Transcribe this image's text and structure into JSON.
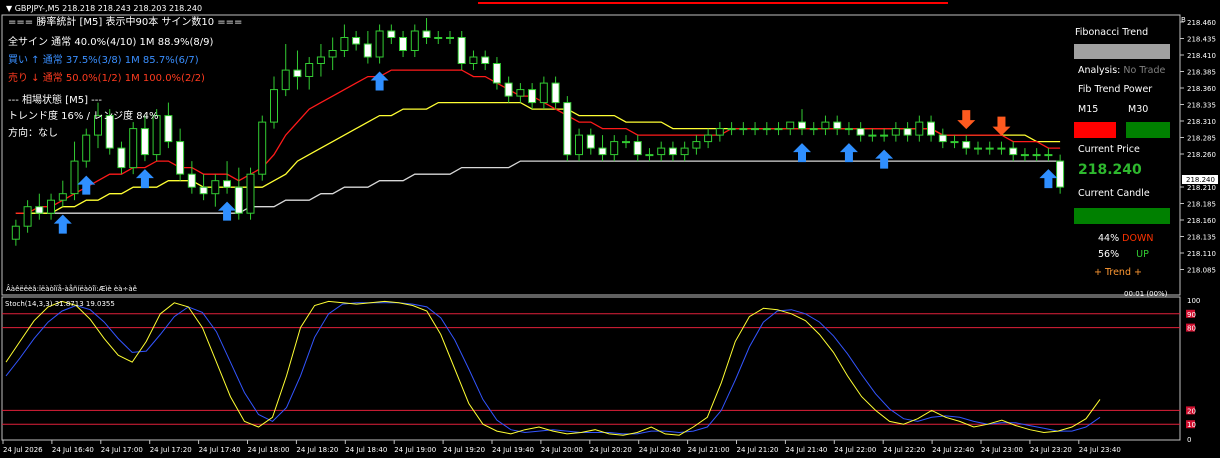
{
  "header": {
    "symbol_line": "▼ GBPJPY-,M5  218.218 218.243 218.203 218.240"
  },
  "stats": {
    "title": "=== 勝率統計 [M5] 表示中90本 サイン数10 ===",
    "all_label": "全サイン  通常 40.0%(4/10)    1M 88.9%(8/9)",
    "buy_label": "買い ↑    通常 37.5%(3/8)    1M 85.7%(6/7)",
    "sell_label": "売り ↓    通常 50.0%(1/2)    1M 100.0%(2/2)",
    "state_title": "--- 相場状態 [M5] ---",
    "trend_label": "トレンド度 16% / レンジ度 84%",
    "direction_label": "方向：なし",
    "garbled_label": "Âàêëëèâ:ïëàòîïå-àåñíëàòîï:Æìè èà÷àê"
  },
  "panel": {
    "title": "Fibonacci Trend",
    "analysis_label": "Analysis:",
    "analysis_value": "No Trade",
    "power_label": "Fib Trend Power",
    "m15_label": "M15",
    "m30_label": "M30",
    "current_price_label": "Current Price",
    "current_price_value": "218.240",
    "current_candle_label": "Current Candle",
    "down_pct": "44%",
    "down_label": "DOWN",
    "up_pct": "56%",
    "up_label": "UP",
    "trend_label": "+  Trend  +",
    "timer_label": "00:01 (00%)",
    "colors": {
      "title_bar": "#a0a0a0",
      "m15": "#ff0000",
      "m30": "#008000",
      "price": "#2eb82e",
      "candle": "#008000",
      "down": "#ff3300",
      "up": "#33cc33",
      "trend": "#ff9933",
      "analysis_value": "#808080"
    }
  },
  "stochastic": {
    "label": "Stoch(14,3,3) 31.8713 19.0355",
    "axis_top": "100",
    "axis_bottom": "0",
    "levels": [
      "90",
      "80",
      "20",
      "10"
    ]
  },
  "price_axis": {
    "ticks": [
      "218.460",
      "218.435",
      "218.410",
      "218.385",
      "218.360",
      "218.335",
      "218.310",
      "218.285",
      "218.260",
      "218.240",
      "218.210",
      "218.185",
      "218.160",
      "218.135",
      "218.110",
      "218.085"
    ],
    "current_tag": "218.240",
    "corner_letter": "B"
  },
  "time_axis": {
    "ticks": [
      "24 Jul 2026",
      "24 Jul 16:40",
      "24 Jul 17:00",
      "24 Jul 17:20",
      "24 Jul 17:40",
      "24 Jul 18:00",
      "24 Jul 18:20",
      "24 Jul 18:40",
      "24 Jul 19:00",
      "24 Jul 19:20",
      "24 Jul 19:40",
      "24 Jul 20:00",
      "24 Jul 20:20",
      "24 Jul 20:40",
      "24 Jul 21:00",
      "24 Jul 21:20",
      "24 Jul 21:40",
      "24 Jul 22:00",
      "24 Jul 22:20",
      "24 Jul 22:40",
      "24 Jul 23:00",
      "24 Jul 23:20",
      "24 Jul 23:40"
    ]
  },
  "chart_data": {
    "type": "candlestick",
    "symbol": "GBPJPY-",
    "timeframe": "M5",
    "ylim": [
      218.075,
      218.47
    ],
    "candles": [
      [
        218.13,
        218.16,
        218.12,
        218.15
      ],
      [
        218.15,
        218.19,
        218.14,
        218.18
      ],
      [
        218.18,
        218.2,
        218.16,
        218.17
      ],
      [
        218.17,
        218.2,
        218.16,
        218.19
      ],
      [
        218.19,
        218.22,
        218.18,
        218.2
      ],
      [
        218.2,
        218.28,
        218.19,
        218.25
      ],
      [
        218.25,
        218.3,
        218.24,
        218.29
      ],
      [
        218.29,
        218.34,
        218.27,
        218.32
      ],
      [
        218.32,
        218.33,
        218.26,
        218.27
      ],
      [
        218.27,
        218.28,
        218.23,
        218.24
      ],
      [
        218.24,
        218.31,
        218.23,
        218.3
      ],
      [
        218.3,
        218.32,
        218.25,
        218.26
      ],
      [
        218.26,
        218.33,
        218.25,
        218.32
      ],
      [
        218.32,
        218.34,
        218.27,
        218.28
      ],
      [
        218.28,
        218.3,
        218.22,
        218.23
      ],
      [
        218.23,
        218.25,
        218.2,
        218.21
      ],
      [
        218.21,
        218.23,
        218.19,
        218.2
      ],
      [
        218.2,
        218.23,
        218.18,
        218.22
      ],
      [
        218.22,
        218.25,
        218.2,
        218.21
      ],
      [
        218.21,
        218.24,
        218.16,
        218.17
      ],
      [
        218.17,
        218.24,
        218.16,
        218.23
      ],
      [
        218.23,
        218.32,
        218.22,
        218.31
      ],
      [
        218.31,
        218.38,
        218.3,
        218.36
      ],
      [
        218.36,
        218.43,
        218.35,
        218.39
      ],
      [
        218.39,
        218.42,
        218.36,
        218.38
      ],
      [
        218.38,
        218.41,
        218.36,
        218.4
      ],
      [
        218.4,
        218.43,
        218.38,
        218.41
      ],
      [
        218.41,
        218.44,
        218.39,
        218.42
      ],
      [
        218.42,
        218.46,
        218.41,
        218.44
      ],
      [
        218.44,
        218.45,
        218.42,
        218.43
      ],
      [
        218.43,
        218.45,
        218.4,
        218.41
      ],
      [
        218.41,
        218.46,
        218.4,
        218.45
      ],
      [
        218.45,
        218.46,
        218.43,
        218.44
      ],
      [
        218.44,
        218.45,
        218.41,
        218.42
      ],
      [
        218.42,
        218.46,
        218.41,
        218.45
      ],
      [
        218.45,
        218.47,
        218.43,
        218.44
      ],
      [
        218.44,
        218.45,
        218.43,
        218.44
      ],
      [
        218.44,
        218.45,
        218.43,
        218.44
      ],
      [
        218.44,
        218.45,
        218.39,
        218.4
      ],
      [
        218.4,
        218.42,
        218.39,
        218.41
      ],
      [
        218.41,
        218.42,
        218.39,
        218.4
      ],
      [
        218.4,
        218.41,
        218.36,
        218.37
      ],
      [
        218.37,
        218.38,
        218.34,
        218.35
      ],
      [
        218.35,
        218.37,
        218.34,
        218.36
      ],
      [
        218.36,
        218.37,
        218.33,
        218.34
      ],
      [
        218.34,
        218.38,
        218.33,
        218.37
      ],
      [
        218.37,
        218.38,
        218.33,
        218.34
      ],
      [
        218.34,
        218.35,
        218.25,
        218.26
      ],
      [
        218.26,
        218.3,
        218.25,
        218.29
      ],
      [
        218.29,
        218.3,
        218.26,
        218.27
      ],
      [
        218.27,
        218.29,
        218.25,
        218.26
      ],
      [
        218.26,
        218.29,
        218.25,
        218.28
      ],
      [
        218.28,
        218.29,
        218.27,
        218.28
      ],
      [
        218.28,
        218.29,
        218.25,
        218.26
      ],
      [
        218.26,
        218.27,
        218.25,
        218.26
      ],
      [
        218.26,
        218.28,
        218.25,
        218.27
      ],
      [
        218.27,
        218.28,
        218.25,
        218.26
      ],
      [
        218.26,
        218.28,
        218.25,
        218.27
      ],
      [
        218.27,
        218.29,
        218.26,
        218.28
      ],
      [
        218.28,
        218.3,
        218.27,
        218.29
      ],
      [
        218.29,
        218.31,
        218.28,
        218.3
      ],
      [
        218.3,
        218.31,
        218.29,
        218.3
      ],
      [
        218.3,
        218.31,
        218.29,
        218.3
      ],
      [
        218.3,
        218.31,
        218.29,
        218.3
      ],
      [
        218.3,
        218.31,
        218.29,
        218.3
      ],
      [
        218.3,
        218.31,
        218.29,
        218.3
      ],
      [
        218.3,
        218.31,
        218.29,
        218.31
      ],
      [
        218.31,
        218.33,
        218.29,
        218.3
      ],
      [
        218.3,
        218.31,
        218.29,
        218.3
      ],
      [
        218.3,
        218.32,
        218.29,
        218.31
      ],
      [
        218.31,
        218.32,
        218.29,
        218.3
      ],
      [
        218.3,
        218.31,
        218.29,
        218.3
      ],
      [
        218.3,
        218.31,
        218.28,
        218.29
      ],
      [
        218.29,
        218.3,
        218.28,
        218.29
      ],
      [
        218.29,
        218.3,
        218.28,
        218.29
      ],
      [
        218.29,
        218.31,
        218.28,
        218.3
      ],
      [
        218.3,
        218.31,
        218.28,
        218.29
      ],
      [
        218.29,
        218.32,
        218.28,
        218.31
      ],
      [
        218.31,
        218.32,
        218.28,
        218.29
      ],
      [
        218.29,
        218.3,
        218.27,
        218.28
      ],
      [
        218.28,
        218.29,
        218.27,
        218.28
      ],
      [
        218.28,
        218.29,
        218.26,
        218.27
      ],
      [
        218.27,
        218.28,
        218.26,
        218.27
      ],
      [
        218.27,
        218.28,
        218.26,
        218.27
      ],
      [
        218.27,
        218.28,
        218.26,
        218.27
      ],
      [
        218.27,
        218.28,
        218.25,
        218.26
      ],
      [
        218.26,
        218.27,
        218.25,
        218.26
      ],
      [
        218.26,
        218.27,
        218.25,
        218.26
      ],
      [
        218.26,
        218.27,
        218.25,
        218.26
      ],
      [
        218.25,
        218.26,
        218.2,
        218.21
      ]
    ],
    "ema_red": [
      218.17,
      218.17,
      218.18,
      218.18,
      218.19,
      218.2,
      218.21,
      218.22,
      218.23,
      218.23,
      218.24,
      218.24,
      218.25,
      218.25,
      218.24,
      218.24,
      218.23,
      218.23,
      218.23,
      218.22,
      218.23,
      218.24,
      218.26,
      218.29,
      218.31,
      218.33,
      218.34,
      218.35,
      218.36,
      218.37,
      218.38,
      218.38,
      218.39,
      218.39,
      218.39,
      218.39,
      218.39,
      218.39,
      218.39,
      218.38,
      218.38,
      218.37,
      218.36,
      218.35,
      218.35,
      218.34,
      218.33,
      218.32,
      218.31,
      218.31,
      218.3,
      218.3,
      218.3,
      218.29,
      218.29,
      218.29,
      218.29,
      218.29,
      218.29,
      218.29,
      218.29,
      218.3,
      218.3,
      218.3,
      218.3,
      218.3,
      218.3,
      218.3,
      218.3,
      218.3,
      218.3,
      218.3,
      218.3,
      218.3,
      218.3,
      218.3,
      218.3,
      218.3,
      218.3,
      218.29,
      218.29,
      218.29,
      218.29,
      218.29,
      218.29,
      218.28,
      218.28,
      218.28,
      218.27,
      218.27
    ],
    "ema_yellow": [
      218.17,
      218.17,
      218.17,
      218.17,
      218.18,
      218.18,
      218.19,
      218.19,
      218.2,
      218.2,
      218.21,
      218.21,
      218.21,
      218.22,
      218.22,
      218.22,
      218.21,
      218.21,
      218.21,
      218.21,
      218.21,
      218.21,
      218.22,
      218.23,
      218.25,
      218.26,
      218.27,
      218.28,
      218.29,
      218.3,
      218.31,
      218.32,
      218.32,
      218.33,
      218.33,
      218.33,
      218.34,
      218.34,
      218.34,
      218.34,
      218.34,
      218.34,
      218.34,
      218.34,
      218.33,
      218.33,
      218.33,
      218.33,
      218.32,
      218.32,
      218.32,
      218.32,
      218.31,
      218.31,
      218.31,
      218.31,
      218.3,
      218.3,
      218.3,
      218.3,
      218.3,
      218.3,
      218.3,
      218.3,
      218.3,
      218.3,
      218.3,
      218.3,
      218.3,
      218.3,
      218.3,
      218.3,
      218.3,
      218.3,
      218.3,
      218.3,
      218.3,
      218.3,
      218.3,
      218.29,
      218.29,
      218.29,
      218.29,
      218.29,
      218.29,
      218.29,
      218.29,
      218.28,
      218.28,
      218.28
    ],
    "ema_white": [
      218.17,
      218.17,
      218.17,
      218.17,
      218.17,
      218.17,
      218.17,
      218.17,
      218.17,
      218.17,
      218.17,
      218.17,
      218.17,
      218.17,
      218.17,
      218.17,
      218.17,
      218.17,
      218.17,
      218.17,
      218.18,
      218.18,
      218.18,
      218.19,
      218.19,
      218.19,
      218.2,
      218.2,
      218.21,
      218.21,
      218.21,
      218.22,
      218.22,
      218.22,
      218.23,
      218.23,
      218.23,
      218.23,
      218.24,
      218.24,
      218.24,
      218.24,
      218.24,
      218.25,
      218.25,
      218.25,
      218.25,
      218.25,
      218.25,
      218.25,
      218.25,
      218.25,
      218.25,
      218.25,
      218.25,
      218.25,
      218.25,
      218.25,
      218.25,
      218.25,
      218.25,
      218.25,
      218.25,
      218.25,
      218.25,
      218.25,
      218.25,
      218.25,
      218.25,
      218.25,
      218.25,
      218.25,
      218.25,
      218.25,
      218.25,
      218.25,
      218.25,
      218.25,
      218.25,
      218.25,
      218.25,
      218.25,
      218.25,
      218.25,
      218.25,
      218.25,
      218.25,
      218.25,
      218.25,
      218.25
    ],
    "buy_arrows": [
      4,
      6,
      11,
      18,
      31,
      67,
      71,
      74,
      88
    ],
    "sell_arrows": [
      81,
      84
    ],
    "stoch_k": [
      55,
      70,
      85,
      95,
      99,
      96,
      86,
      72,
      60,
      55,
      70,
      90,
      98,
      95,
      80,
      55,
      30,
      12,
      8,
      15,
      45,
      80,
      96,
      99,
      98,
      97,
      98,
      99,
      98,
      96,
      92,
      75,
      50,
      25,
      10,
      5,
      3,
      6,
      8,
      5,
      3,
      4,
      6,
      3,
      2,
      4,
      8,
      3,
      2,
      8,
      15,
      40,
      70,
      88,
      94,
      93,
      90,
      85,
      75,
      62,
      45,
      30,
      20,
      12,
      10,
      14,
      20,
      15,
      12,
      8,
      10,
      13,
      9,
      6,
      4,
      5,
      8,
      14,
      28
    ],
    "stoch_d": [
      45,
      58,
      72,
      84,
      92,
      96,
      93,
      84,
      72,
      62,
      63,
      75,
      88,
      95,
      91,
      77,
      55,
      33,
      17,
      12,
      22,
      45,
      73,
      90,
      97,
      98,
      98,
      98,
      98,
      97,
      95,
      87,
      71,
      50,
      28,
      13,
      6,
      4,
      5,
      6,
      5,
      4,
      4,
      4,
      3,
      3,
      5,
      5,
      4,
      5,
      8,
      20,
      42,
      66,
      84,
      92,
      93,
      90,
      84,
      74,
      61,
      46,
      32,
      21,
      14,
      12,
      15,
      16,
      15,
      12,
      10,
      11,
      11,
      9,
      7,
      5,
      5,
      8,
      15
    ]
  }
}
